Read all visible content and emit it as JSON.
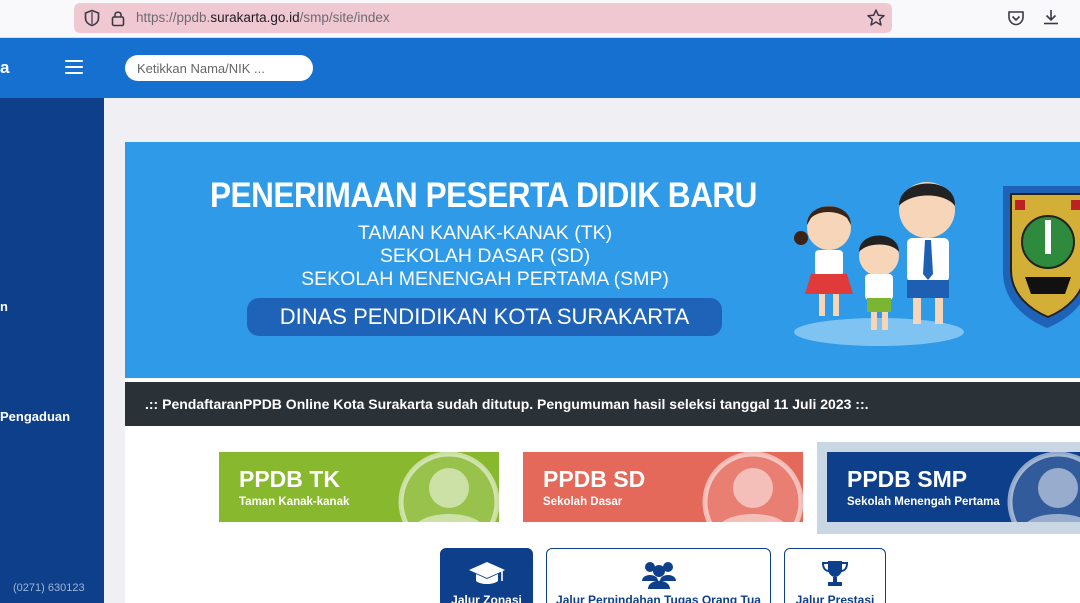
{
  "browser": {
    "url_prefix": "https://ppdb.",
    "url_domain": "surakarta.go.id",
    "url_path": "/smp/site/index"
  },
  "header": {
    "brand_fragment": "a",
    "search_placeholder": "Ketikkan Nama/NIK ..."
  },
  "sidebar": {
    "items": [
      {
        "label": "n"
      },
      {
        "label": "Pengaduan"
      }
    ],
    "phone": "(0271) 630123"
  },
  "banner": {
    "title": "PENERIMAAN PESERTA DIDIK BARU",
    "lines": [
      "TAMAN KANAK-KANAK (TK)",
      "SEKOLAH DASAR (SD)",
      "SEKOLAH MENENGAH PERTAMA (SMP)"
    ],
    "agency": "DINAS PENDIDIKAN KOTA SURAKARTA"
  },
  "ticker": {
    "text": ".:: PendaftaranPPDB Online Kota Surakarta sudah ditutup. Pengumuman hasil seleksi tanggal 11 Juli 2023 ::."
  },
  "tiles": [
    {
      "title": "PPDB TK",
      "subtitle": "Taman Kanak-kanak",
      "color": "#88b82d"
    },
    {
      "title": "PPDB SD",
      "subtitle": "Sekolah Dasar",
      "color": "#e4695a"
    },
    {
      "title": "PPDB SMP",
      "subtitle": "Sekolah Menengah Pertama",
      "color": "#0d3f8a"
    }
  ],
  "jalur": [
    {
      "label": "Jalur Zonasi",
      "icon": "graduation-cap-icon"
    },
    {
      "label": "Jalur Perpindahan Tugas Orang Tua",
      "icon": "group-icon"
    },
    {
      "label": "Jalur Prestasi",
      "icon": "trophy-icon"
    }
  ],
  "colors": {
    "header": "#1670d0",
    "sidebar": "#0d3f8a",
    "banner": "#2f9ae8",
    "ticker": "#2a3238"
  }
}
